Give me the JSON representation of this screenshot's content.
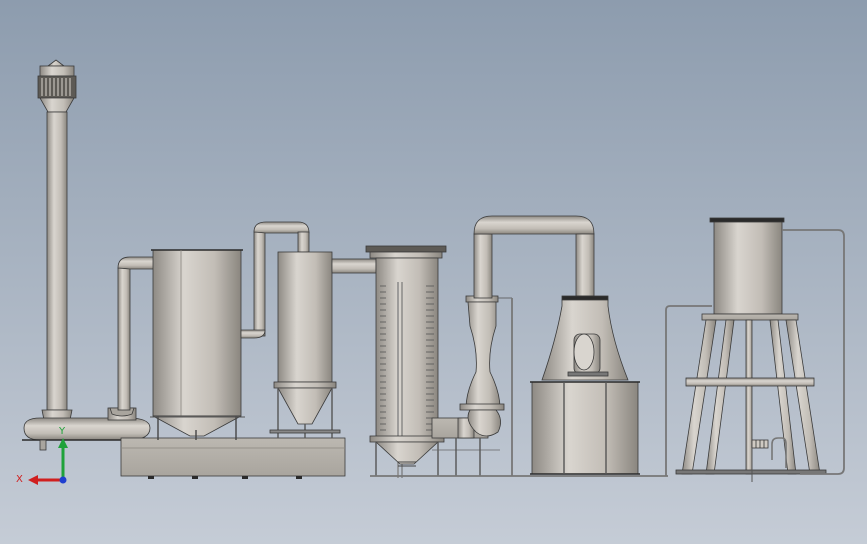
{
  "viewport": {
    "background_top": "#8d9cae",
    "background_bottom": "#c5ccd6"
  },
  "triad": {
    "x_label": "X",
    "y_label": "Y",
    "x_color": "#d01f1f",
    "y_color": "#1fa23a",
    "z_color": "#1f3fd0"
  },
  "palette": {
    "metal_light": "#d9d5cf",
    "metal_mid": "#b7b2aa",
    "metal_dark": "#7a7670",
    "edge": "#3a3a3a"
  }
}
